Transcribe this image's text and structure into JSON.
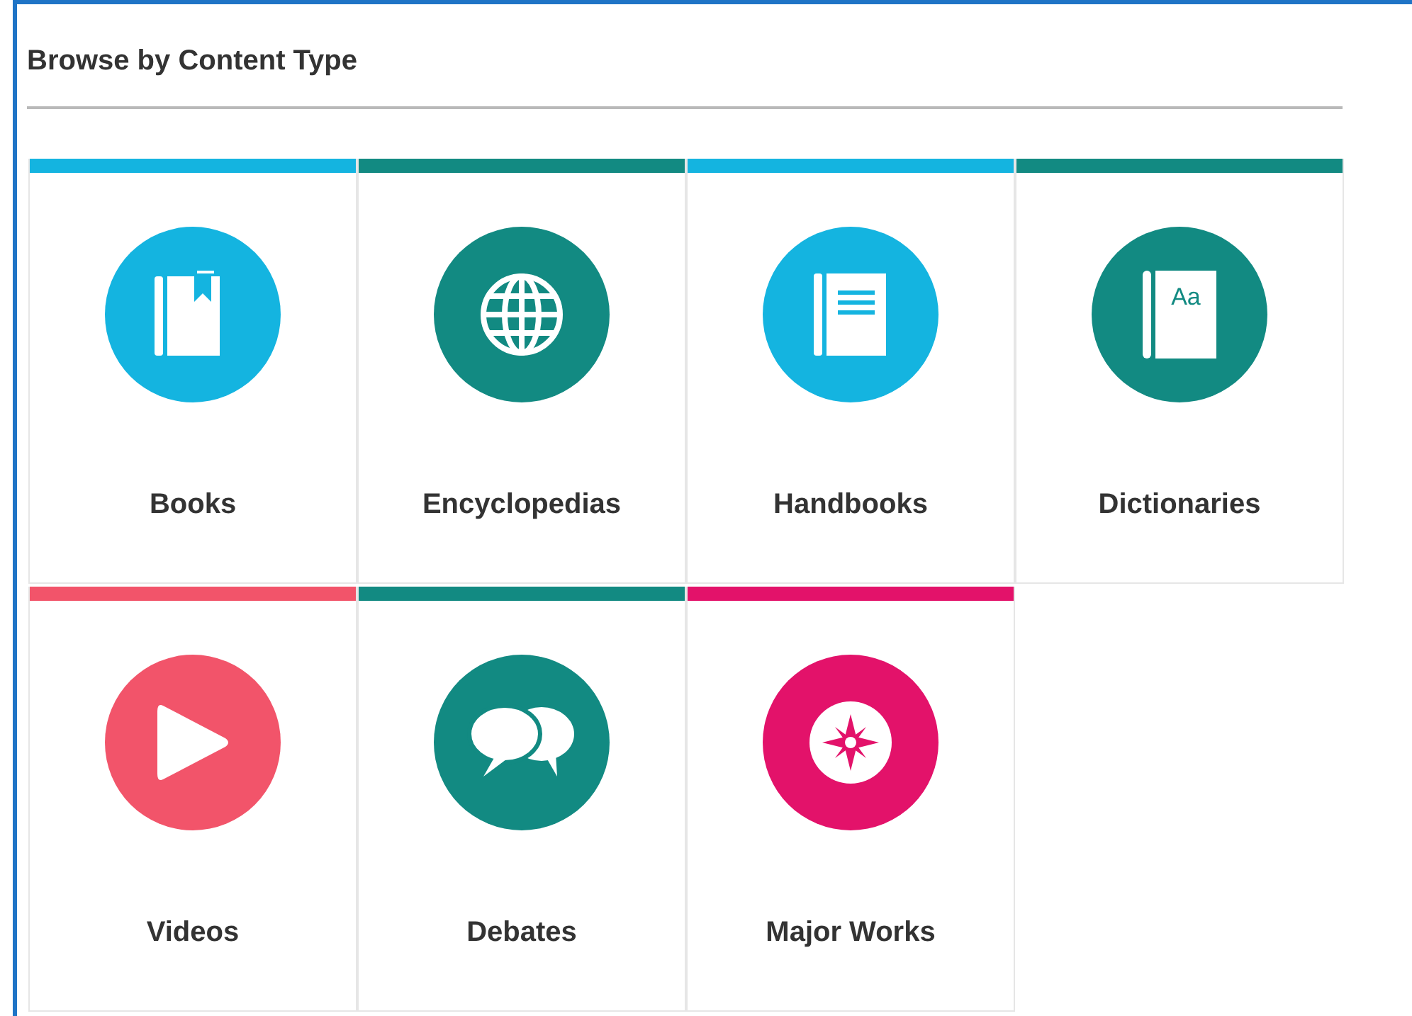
{
  "title": "Browse by Content Type",
  "tiles": [
    {
      "label": "Books",
      "kind": "bookmark-book",
      "color": "#14b4e0"
    },
    {
      "label": "Encyclopedias",
      "kind": "globe",
      "color": "#128a82"
    },
    {
      "label": "Handbooks",
      "kind": "lined-book",
      "color": "#14b4e0"
    },
    {
      "label": "Dictionaries",
      "kind": "letter-book",
      "color": "#128a82",
      "icon_text": "Aa"
    },
    {
      "label": "Videos",
      "kind": "play",
      "color": "#f2546a"
    },
    {
      "label": "Debates",
      "kind": "speech",
      "color": "#128a82"
    },
    {
      "label": "Major Works",
      "kind": "compass",
      "color": "#e3126a"
    }
  ]
}
